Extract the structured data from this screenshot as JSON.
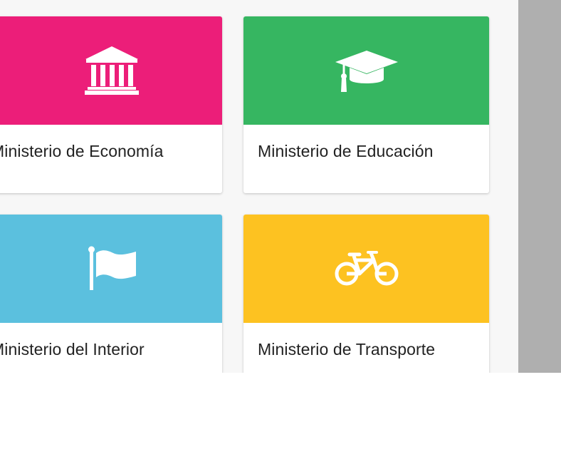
{
  "cards": [
    {
      "label": "Ministerio de Economía",
      "color": "#ec1e79",
      "icon": "bank-icon"
    },
    {
      "label": "Ministerio de Educación",
      "color": "#36b661",
      "icon": "graduation-cap-icon"
    },
    {
      "label": "Ministerio del Interior",
      "color": "#5bc0de",
      "icon": "flag-icon"
    },
    {
      "label": "Ministerio de Transporte",
      "color": "#fdc221",
      "icon": "bicycle-icon"
    }
  ]
}
